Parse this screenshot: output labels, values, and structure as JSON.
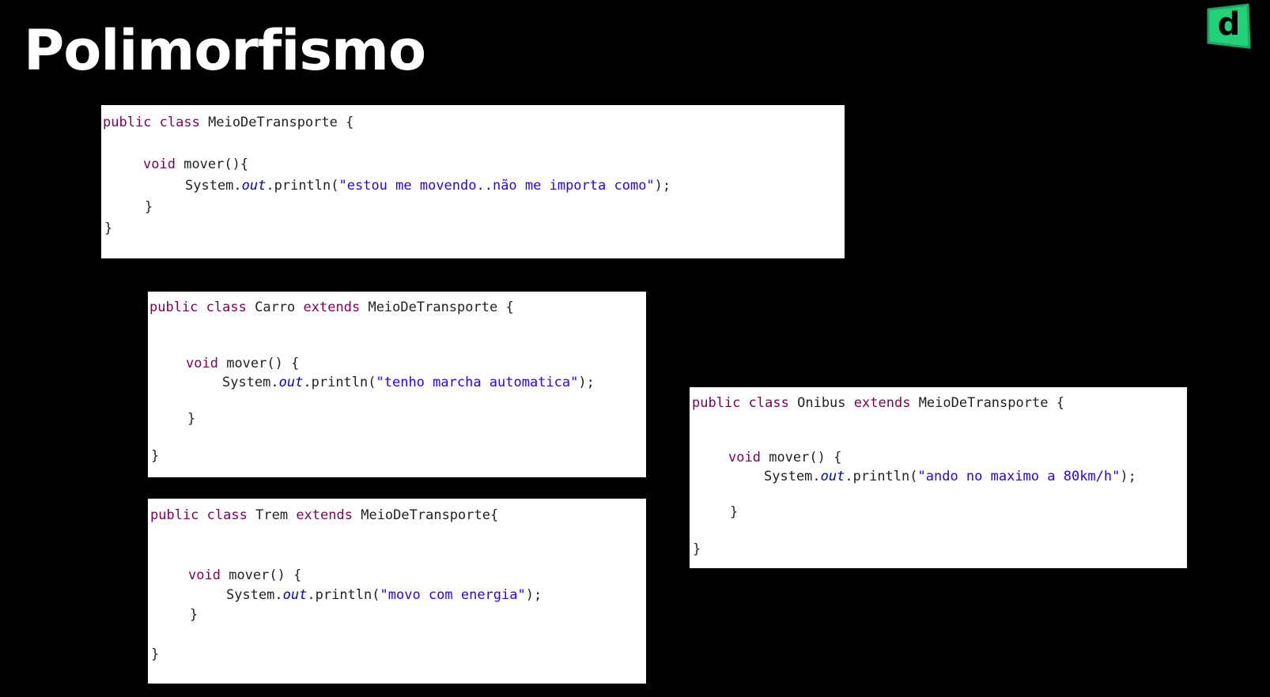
{
  "slide": {
    "title": "Polimorfismo",
    "logo": {
      "letter": "d",
      "color": "#23d178",
      "icon": "logo-d-icon"
    }
  },
  "code_blocks": {
    "meio_de_transporte": {
      "kw_public": "public",
      "kw_class": "class",
      "class_name": "MeioDeTransporte",
      "open_brace": "{",
      "kw_void": "void",
      "method_sig": "mover(){",
      "system": "System.",
      "out": "out",
      "println": ".println(",
      "string": "\"estou me movendo..não me importa como\"",
      "stmt_end": ");",
      "method_close": "}",
      "class_close": "}"
    },
    "carro": {
      "kw_public": "public",
      "kw_class": "class",
      "class_name": "Carro",
      "kw_extends": "extends",
      "parent": "MeioDeTransporte",
      "open_brace": "{",
      "kw_void": "void",
      "method_sig": "mover() {",
      "system": "System.",
      "out": "out",
      "println": ".println(",
      "string": "\"tenho marcha automatica\"",
      "stmt_end": ");",
      "method_close": "}",
      "class_close": "}"
    },
    "trem": {
      "kw_public": "public",
      "kw_class": "class",
      "class_name": "Trem",
      "kw_extends": "extends",
      "parent": "MeioDeTransporte{",
      "kw_void": "void",
      "method_sig": "mover() {",
      "system": "System.",
      "out": "out",
      "println": ".println(",
      "string": "\"movo com energia\"",
      "stmt_end": ");",
      "method_close": "}",
      "class_close": "}"
    },
    "onibus": {
      "kw_public": "public",
      "kw_class": "class",
      "class_name": "Onibus",
      "kw_extends": "extends",
      "parent": "MeioDeTransporte",
      "open_brace": "{",
      "kw_void": "void",
      "method_sig": "mover() {",
      "system": "System.",
      "out": "out",
      "println": ".println(",
      "string": "\"ando no maximo a 80km/h\"",
      "stmt_end": ");",
      "method_close": "}",
      "class_close": "}"
    }
  },
  "colors": {
    "background": "#000000",
    "keyword": "#7f0055",
    "string": "#2a00ff",
    "field": "#0000c0",
    "logo": "#23d178"
  }
}
